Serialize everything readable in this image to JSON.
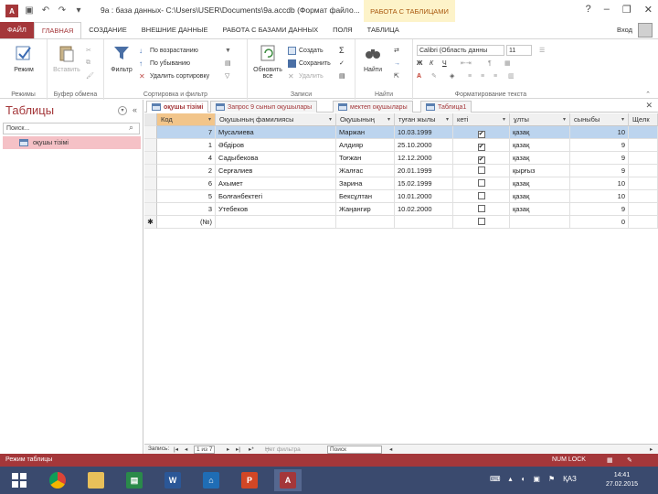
{
  "window": {
    "app_badge": "A",
    "title": "9a : база данных- C:\\Users\\USER\\Documents\\9a.accdb (Формат файло...",
    "context_title": "РАБОТА С ТАБЛИЦАМИ",
    "controls": [
      "?",
      "–",
      "❐",
      "✕"
    ]
  },
  "tabs": {
    "file": "ФАЙЛ",
    "home": "ГЛАВНАЯ",
    "create": "СОЗДАНИЕ",
    "external": "ВНЕШНИЕ ДАННЫЕ",
    "dbtools": "РАБОТА С БАЗАМИ ДАННЫХ",
    "fields": "ПОЛЯ",
    "table": "ТАБЛИЦА",
    "signin": "Вход"
  },
  "ribbon": {
    "views": {
      "mode": "Режим",
      "label": "Режимы"
    },
    "clipboard": {
      "paste": "Вставить",
      "label": "Буфер обмена"
    },
    "sort": {
      "filter": "Фильтр",
      "asc": "По возрастанию",
      "desc": "По убыванию",
      "remove_sort": "Удалить сортировку",
      "label": "Сортировка и фильтр"
    },
    "records": {
      "refresh": "Обновить все",
      "new": "Создать",
      "save": "Сохранить",
      "delete": "Удалить",
      "label": "Записи"
    },
    "find": {
      "find": "Найти",
      "label": "Найти"
    },
    "format": {
      "font": "Calibri (Область данны",
      "size": "11",
      "label": "Форматирование текста"
    }
  },
  "nav": {
    "title": "Таблицы",
    "search_value": "Поиск...",
    "items": [
      "оқушы тізімі"
    ]
  },
  "doctabs": [
    "оқушы тізімі",
    "Запрос 9 сынып оқушылары",
    "мектеп оқушылары",
    "Таблица1"
  ],
  "datasheet": {
    "columns": [
      "Код",
      "Оқушының фамилиясы",
      "Оқушының",
      "туған жылы",
      "кеті",
      "ұлты",
      "сыныбы",
      "Щелк"
    ],
    "rows": [
      {
        "code": "7",
        "surname": "Мусалиева",
        "name": "Маржан",
        "birth": "10.03.1999",
        "checked": "✔",
        "nation": "қазақ",
        "grade": "10",
        "selected": true
      },
      {
        "code": "1",
        "surname": "Әбдіров",
        "name": "Алдияр",
        "birth": "25.10.2000",
        "checked": "✔",
        "nation": "қазақ",
        "grade": "9"
      },
      {
        "code": "4",
        "surname": "Садыбекова",
        "name": "Тоғжан",
        "birth": "12.12.2000",
        "checked": "✔",
        "nation": "қазақ",
        "grade": "9"
      },
      {
        "code": "2",
        "surname": "Серғалиев",
        "name": "Жалғас",
        "birth": "20.01.1999",
        "checked": "",
        "nation": "қырғыз",
        "grade": "9"
      },
      {
        "code": "6",
        "surname": "Ахымет",
        "name": "Зарина",
        "birth": "15.02.1999",
        "checked": "",
        "nation": "қазақ",
        "grade": "10"
      },
      {
        "code": "5",
        "surname": "Болғанбектегі",
        "name": "Бексұлтан",
        "birth": "10.01.2000",
        "checked": "",
        "nation": "қазақ",
        "grade": "10"
      },
      {
        "code": "3",
        "surname": "Утебеков",
        "name": "Жаңангир",
        "birth": "10.02.2000",
        "checked": "",
        "nation": "қазақ",
        "grade": "9"
      }
    ],
    "new_row": {
      "code": "(№)",
      "grade": "0"
    }
  },
  "recnav": {
    "label": "Запись:",
    "position": "1 из 7",
    "filter": "Нет фильтра",
    "search": "Поиск"
  },
  "status": {
    "mode": "Режим таблицы",
    "numlock": "NUM LOCK"
  },
  "taskbar": {
    "lang": "ҚАЗ",
    "time": "14:41",
    "date": "27.02.2015"
  },
  "colors": {
    "accent": "#a4373a",
    "selected_row": "#bcd4ee",
    "nav_selected": "#f5c1c6",
    "taskbar": "#3a4a6e"
  }
}
